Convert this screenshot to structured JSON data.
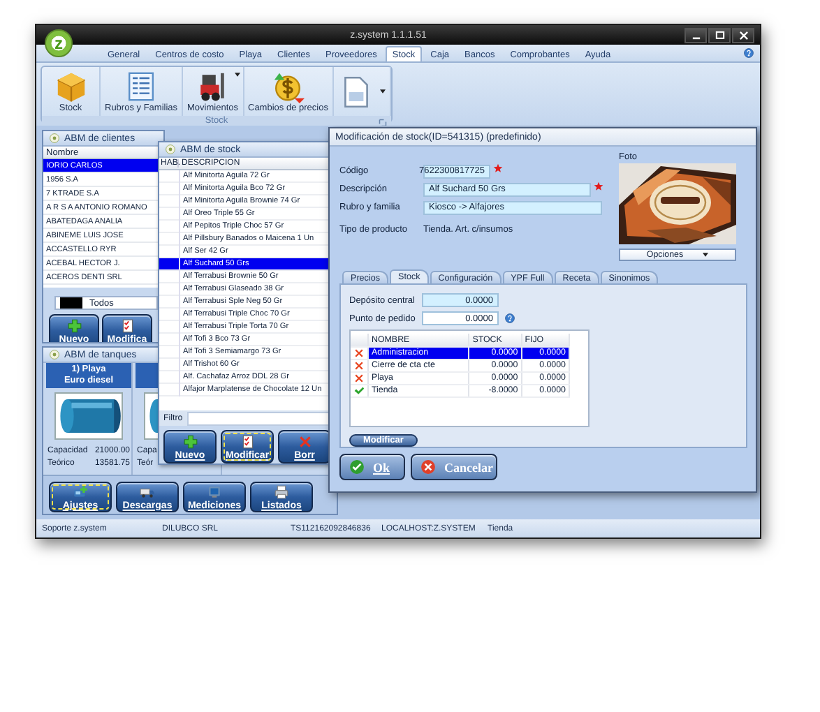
{
  "window": {
    "logo": "z",
    "title": "z.system 1.1.1.51"
  },
  "menu": {
    "tabs": [
      {
        "label": "General",
        "selected": false
      },
      {
        "label": "Centros de costo",
        "selected": false
      },
      {
        "label": "Playa",
        "selected": false
      },
      {
        "label": "Clientes",
        "selected": false
      },
      {
        "label": "Proveedores",
        "selected": false
      },
      {
        "label": "Stock",
        "selected": true
      },
      {
        "label": "Caja",
        "selected": false
      },
      {
        "label": "Bancos",
        "selected": false
      },
      {
        "label": "Comprobantes",
        "selected": false
      },
      {
        "label": "Ayuda",
        "selected": false
      }
    ]
  },
  "ribbon": {
    "buttons": [
      {
        "label": "Stock",
        "kind": "box",
        "dropdown": false
      },
      {
        "label": "Rubros y Familias",
        "kind": "list",
        "dropdown": false
      },
      {
        "label": "Movimientos",
        "kind": "forklift",
        "dropdown": true
      },
      {
        "label": "Cambios de precios",
        "kind": "price",
        "dropdown": false
      },
      {
        "kind": "document",
        "dropdown": true
      }
    ],
    "group": "Stock"
  },
  "clients": {
    "title": "ABM de clientes",
    "column": "Nombre",
    "rows": [
      {
        "name": "IORIO CARLOS",
        "selected": true
      },
      {
        "name": "1956 S.A",
        "selected": false
      },
      {
        "name": "7 KTRADE S.A",
        "selected": false
      },
      {
        "name": "A R S A ANTONIO ROMANO",
        "selected": false
      },
      {
        "name": "ABATEDAGA ANALIA",
        "selected": false
      },
      {
        "name": "ABINEME LUIS JOSE",
        "selected": false
      },
      {
        "name": "ACCASTELLO RYR",
        "selected": false
      },
      {
        "name": "ACEBAL HECTOR J.",
        "selected": false
      },
      {
        "name": "ACEROS DENTI SRL",
        "selected": false
      }
    ],
    "filter": "Todos",
    "buttons": [
      {
        "label": "Nuevo",
        "kind": "plus",
        "focused": false
      },
      {
        "label": "Modifica",
        "kind": "clipboard",
        "focused": false
      }
    ]
  },
  "tanks": {
    "title": "ABM de tanques",
    "tanks": [
      {
        "name": "1) Playa",
        "product": "Euro diesel",
        "rows": [
          {
            "label": "Capacidad",
            "value": "21000.00"
          },
          {
            "label": "Teórico",
            "value": "13581.75"
          }
        ]
      },
      {
        "rows": [
          {
            "label": "Capa"
          },
          {
            "label": "Teór"
          }
        ]
      }
    ],
    "buttons": [
      {
        "label": "Ajustes",
        "kind": "tool",
        "focused": true
      },
      {
        "label": "Descargas",
        "kind": "truck",
        "focused": false
      },
      {
        "label": "Mediciones",
        "kind": "gauge",
        "focused": false
      },
      {
        "label": "Listados",
        "kind": "printer",
        "focused": false
      }
    ]
  },
  "stock_list": {
    "title": "ABM de stock",
    "columns": [
      "HAB.",
      "DESCRIPCION"
    ],
    "rows": [
      {
        "description": "Alf Minitorta Aguila 72 Gr",
        "selected": false
      },
      {
        "description": "Alf Minitorta Aguila Bco 72 Gr",
        "selected": false
      },
      {
        "description": "Alf Minitorta Aguila Brownie 74 Gr",
        "selected": false
      },
      {
        "description": "Alf Oreo Triple 55 Gr",
        "selected": false
      },
      {
        "description": "Alf Pepitos Triple Choc 57 Gr",
        "selected": false
      },
      {
        "description": "Alf Pillsbury Banados o Maicena 1 Un",
        "selected": false
      },
      {
        "description": "Alf Ser 42 Gr",
        "selected": false
      },
      {
        "description": "Alf Suchard 50 Grs",
        "selected": true
      },
      {
        "description": "Alf Terrabusi Brownie 50 Gr",
        "selected": false
      },
      {
        "description": "Alf Terrabusi Glaseado 38 Gr",
        "selected": false
      },
      {
        "description": "Alf Terrabusi Sple Neg 50 Gr",
        "selected": false
      },
      {
        "description": "Alf Terrabusi Triple Choc 70 Gr",
        "selected": false
      },
      {
        "description": "Alf Terrabusi Triple Torta 70 Gr",
        "selected": false
      },
      {
        "description": "Alf Tofi 3 Bco 73 Gr",
        "selected": false
      },
      {
        "description": "Alf Tofi 3 Semiamargo 73 Gr",
        "selected": false
      },
      {
        "description": "Alf Trishot 60 Gr",
        "selected": false
      },
      {
        "description": "Alf. Cachafaz Arroz DDL 28 Gr",
        "selected": false
      },
      {
        "description": "Alfajor Marplatense de Chocolate 12 Un",
        "selected": false
      }
    ],
    "filter_label": "Filtro",
    "buttons": [
      {
        "label": "Nuevo",
        "kind": "plus",
        "focused": false
      },
      {
        "label": "Modificar",
        "kind": "clipboard",
        "focused": true
      },
      {
        "label": "Borr",
        "kind": "cross",
        "focused": false
      }
    ]
  },
  "stock_edit": {
    "title": "Modificación de stock(ID=541315) (predefinido)",
    "fields": [
      {
        "label": "Código",
        "value": "7622300817725",
        "required": true
      },
      {
        "label": "Descripción",
        "value": "Alf Suchard 50 Grs",
        "required": true
      },
      {
        "label": "Rubro y familia",
        "value": "Kiosco -> Alfajores",
        "required": false
      }
    ],
    "product_type": {
      "label": "Tipo de producto",
      "value": "Tienda. Art. c/insumos"
    },
    "photo": {
      "label": "Foto",
      "kind": "picture"
    },
    "options": "Opciones",
    "tabs": [
      {
        "label": "Precios",
        "selected": false
      },
      {
        "label": "Stock",
        "selected": true
      },
      {
        "label": "Configuración",
        "selected": false
      },
      {
        "label": "YPF Full",
        "selected": false
      },
      {
        "label": "Receta",
        "selected": false
      },
      {
        "label": "Sinonimos",
        "selected": false
      }
    ],
    "depot_fields": [
      {
        "label": "Depósito central",
        "value": "0.0000",
        "help": false
      },
      {
        "label": "Punto de pedido",
        "value": "0.0000",
        "help": true
      }
    ],
    "depot_table": {
      "columns": [
        "NOMBRE",
        "STOCK",
        "FIJO"
      ],
      "rows": [
        {
          "name": "Administracion",
          "stock": "0.0000",
          "fixed": "0.0000",
          "enabled": false,
          "selected": true
        },
        {
          "name": "Cierre de cta cte",
          "stock": "0.0000",
          "fixed": "0.0000",
          "enabled": false,
          "selected": false
        },
        {
          "name": "Playa",
          "stock": "0.0000",
          "fixed": "0.0000",
          "enabled": false,
          "selected": false
        },
        {
          "name": "Tienda",
          "stock": "-8.0000",
          "fixed": "0.0000",
          "enabled": true,
          "selected": false
        }
      ]
    },
    "modify_button": "Modificar",
    "buttons": [
      {
        "label": "Ok",
        "kind": "ok"
      },
      {
        "label": "Cancelar",
        "kind": "cancel"
      }
    ]
  },
  "status_bar": [
    "Soporte z.system",
    "DILUBCO SRL",
    "TS112162092846836",
    "LOCALHOST:Z.SYSTEM",
    "Tienda"
  ]
}
